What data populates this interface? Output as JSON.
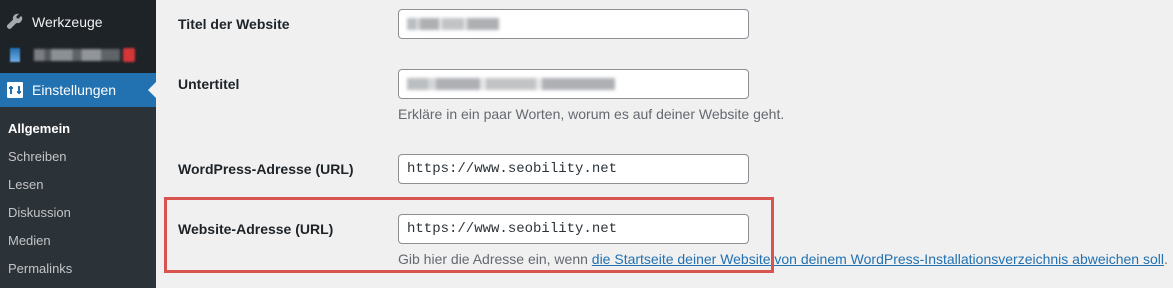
{
  "sidebar": {
    "items": [
      {
        "label": "Werkzeuge",
        "icon": "wrench-icon"
      },
      {
        "label": "Einstellungen",
        "icon": "settings-icon"
      }
    ],
    "submenu": [
      {
        "label": "Allgemein",
        "current": true
      },
      {
        "label": "Schreiben"
      },
      {
        "label": "Lesen"
      },
      {
        "label": "Diskussion"
      },
      {
        "label": "Medien"
      },
      {
        "label": "Permalinks"
      }
    ]
  },
  "form": {
    "site_title_label": "Titel der Website",
    "tagline_label": "Untertitel",
    "tagline_description": "Erkläre in ein paar Worten, worum es auf deiner Website geht.",
    "wp_address_label": "WordPress-Adresse (URL)",
    "wp_address_value": "https://www.seobility.net",
    "site_address_label": "Website-Adresse (URL)",
    "site_address_value": "https://www.seobility.net",
    "site_address_desc_prefix": "Gib hier die Adresse ein, wenn ",
    "site_address_desc_link": "die Startseite deiner Website von deinem WordPress-Installationsverzeichnis abweichen soll",
    "site_address_desc_suffix": "."
  },
  "colors": {
    "sidebar_bg": "#1d2327",
    "active_menu_bg": "#2271b1",
    "link": "#2271b1",
    "highlight_border": "#d9534f"
  }
}
